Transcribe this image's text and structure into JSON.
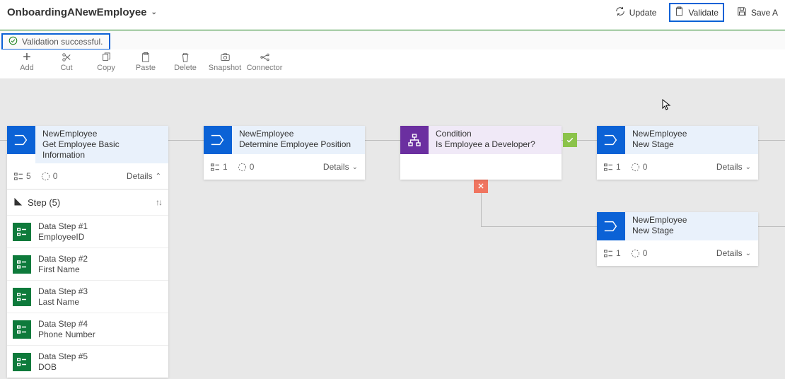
{
  "header": {
    "title": "OnboardingANewEmployee",
    "update": "Update",
    "validate": "Validate",
    "saveas": "Save A"
  },
  "validation": {
    "msg": "Validation successful."
  },
  "toolbar": {
    "add": "Add",
    "cut": "Cut",
    "copy": "Copy",
    "paste": "Paste",
    "delete": "Delete",
    "snapshot": "Snapshot",
    "connector": "Connector"
  },
  "stage1": {
    "name": "NewEmployee",
    "sub": "Get Employee Basic Information",
    "count": "5",
    "flow": "0",
    "details": "Details",
    "stepsHeader": "Step (5)",
    "steps": [
      {
        "t": "Data Step #1",
        "s": "EmployeeID"
      },
      {
        "t": "Data Step #2",
        "s": "First Name"
      },
      {
        "t": "Data Step #3",
        "s": "Last Name"
      },
      {
        "t": "Data Step #4",
        "s": "Phone Number"
      },
      {
        "t": "Data Step #5",
        "s": "DOB"
      }
    ]
  },
  "stage2": {
    "name": "NewEmployee",
    "sub": "Determine Employee Position",
    "count": "1",
    "flow": "0",
    "details": "Details"
  },
  "condition": {
    "name": "Condition",
    "sub": "Is Employee a Developer?"
  },
  "stage3": {
    "name": "NewEmployee",
    "sub": "New Stage",
    "count": "1",
    "flow": "0",
    "details": "Details"
  },
  "stage4": {
    "name": "NewEmployee",
    "sub": "New Stage",
    "count": "1",
    "flow": "0",
    "details": "Details"
  }
}
